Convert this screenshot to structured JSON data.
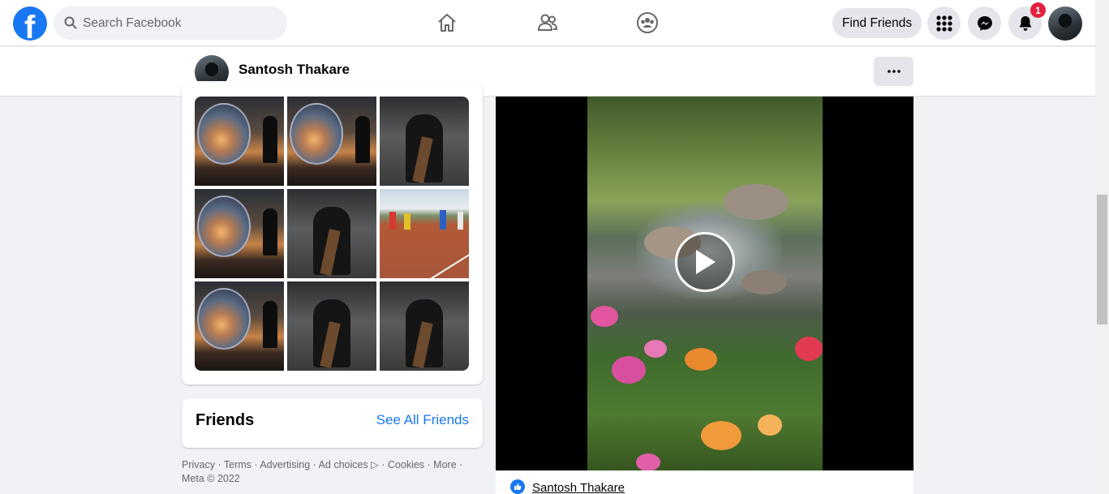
{
  "topbar": {
    "logo_letter": "f",
    "search_placeholder": "Search Facebook",
    "find_friends_label": "Find Friends",
    "notification_count": "1"
  },
  "profile_bar": {
    "name": "Santosh Thakare"
  },
  "photos": [
    {
      "kind": "sunset-orb"
    },
    {
      "kind": "sunset-orb"
    },
    {
      "kind": "camera-man"
    },
    {
      "kind": "sunset-orb"
    },
    {
      "kind": "camera-man"
    },
    {
      "kind": "football-field"
    },
    {
      "kind": "sunset-orb"
    },
    {
      "kind": "camera-man"
    },
    {
      "kind": "camera-man"
    }
  ],
  "friends": {
    "title": "Friends",
    "see_all_label": "See All Friends"
  },
  "footer": {
    "line1": "Privacy · Terms · Advertising · Ad choices ▷ · Cookies · More ·",
    "line2": "Meta © 2022"
  },
  "post": {
    "author": "Santosh Thakare"
  },
  "colors": {
    "brand": "#1877f2",
    "badge": "#e41e3f",
    "background": "#f0f2f5"
  }
}
